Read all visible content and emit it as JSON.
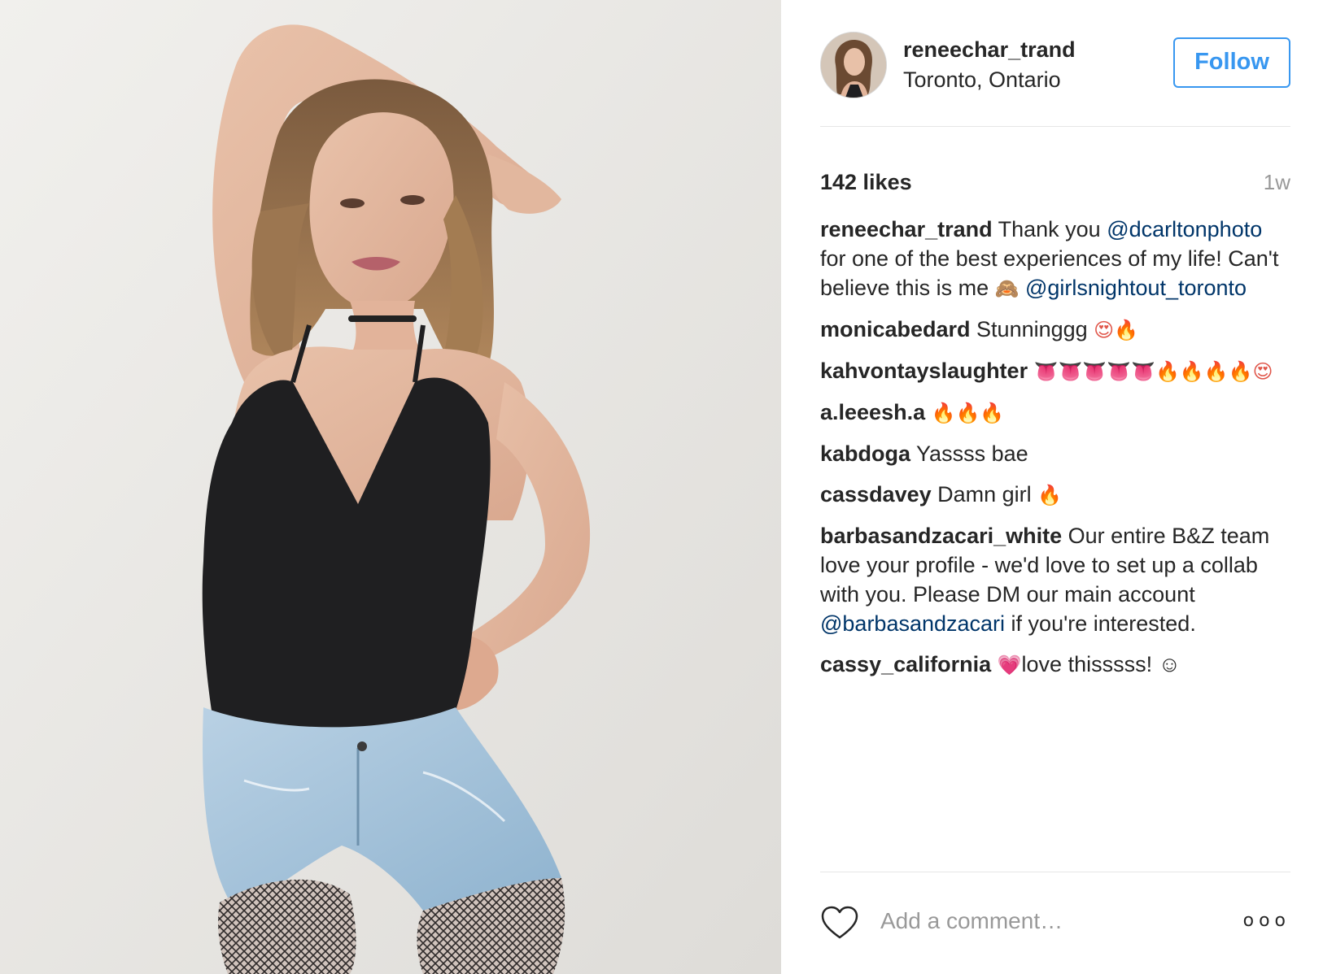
{
  "post": {
    "photo_alt": "",
    "header": {
      "username": "reneechar_trand",
      "location": "Toronto, Ontario",
      "follow_label": "Follow"
    },
    "likes": "142 likes",
    "time_ago": "1w",
    "comments": [
      {
        "author": "reneechar_trand",
        "parts": [
          {
            "text": " Thank you "
          },
          {
            "mention": "@dcarltonphoto"
          },
          {
            "text": " for one of the best experiences of my life! Can't believe this is me "
          },
          {
            "emoji": "🙈",
            "cls": "monkey"
          },
          {
            "text": " "
          },
          {
            "mention": "@girlsnightout_toronto"
          }
        ]
      },
      {
        "author": "monicabedard",
        "parts": [
          {
            "text": " Stunninggg "
          },
          {
            "emoji": "😍",
            "cls": "love"
          },
          {
            "emoji": "🔥",
            "cls": "fire"
          }
        ]
      },
      {
        "author": "kahvontayslaughter",
        "parts": [
          {
            "text": " "
          },
          {
            "emoji": "👅👅👅👅👅",
            "cls": "tongue"
          },
          {
            "emoji": "🔥🔥🔥🔥",
            "cls": "fire"
          },
          {
            "emoji": "😍",
            "cls": "love"
          }
        ]
      },
      {
        "author": "a.leeesh.a",
        "parts": [
          {
            "text": " "
          },
          {
            "emoji": "🔥🔥🔥",
            "cls": "fire"
          }
        ]
      },
      {
        "author": "kabdoga",
        "parts": [
          {
            "text": " Yassss bae"
          }
        ]
      },
      {
        "author": "cassdavey",
        "parts": [
          {
            "text": " Damn girl "
          },
          {
            "emoji": "🔥",
            "cls": "fire"
          }
        ]
      },
      {
        "author": "barbasandzacari_white",
        "parts": [
          {
            "text": " Our entire B&Z team love your profile - we'd love to set up a collab with you. Please DM our main account "
          },
          {
            "mention": "@barbasandzacari"
          },
          {
            "text": " if you're interested."
          }
        ]
      },
      {
        "author": "cassy_california",
        "parts": [
          {
            "text": " "
          },
          {
            "emoji": "💗",
            "cls": "heart"
          },
          {
            "text": "love thisssss! ☺"
          }
        ]
      }
    ],
    "add_comment_placeholder": "Add a comment…",
    "more_label": "ooo",
    "colors": {
      "accent": "#3897f0",
      "mention": "#003569",
      "muted": "#999999",
      "divider": "#e6e6e6"
    },
    "icons": {
      "like": "heart-outline-icon",
      "more": "more-options-icon"
    }
  }
}
